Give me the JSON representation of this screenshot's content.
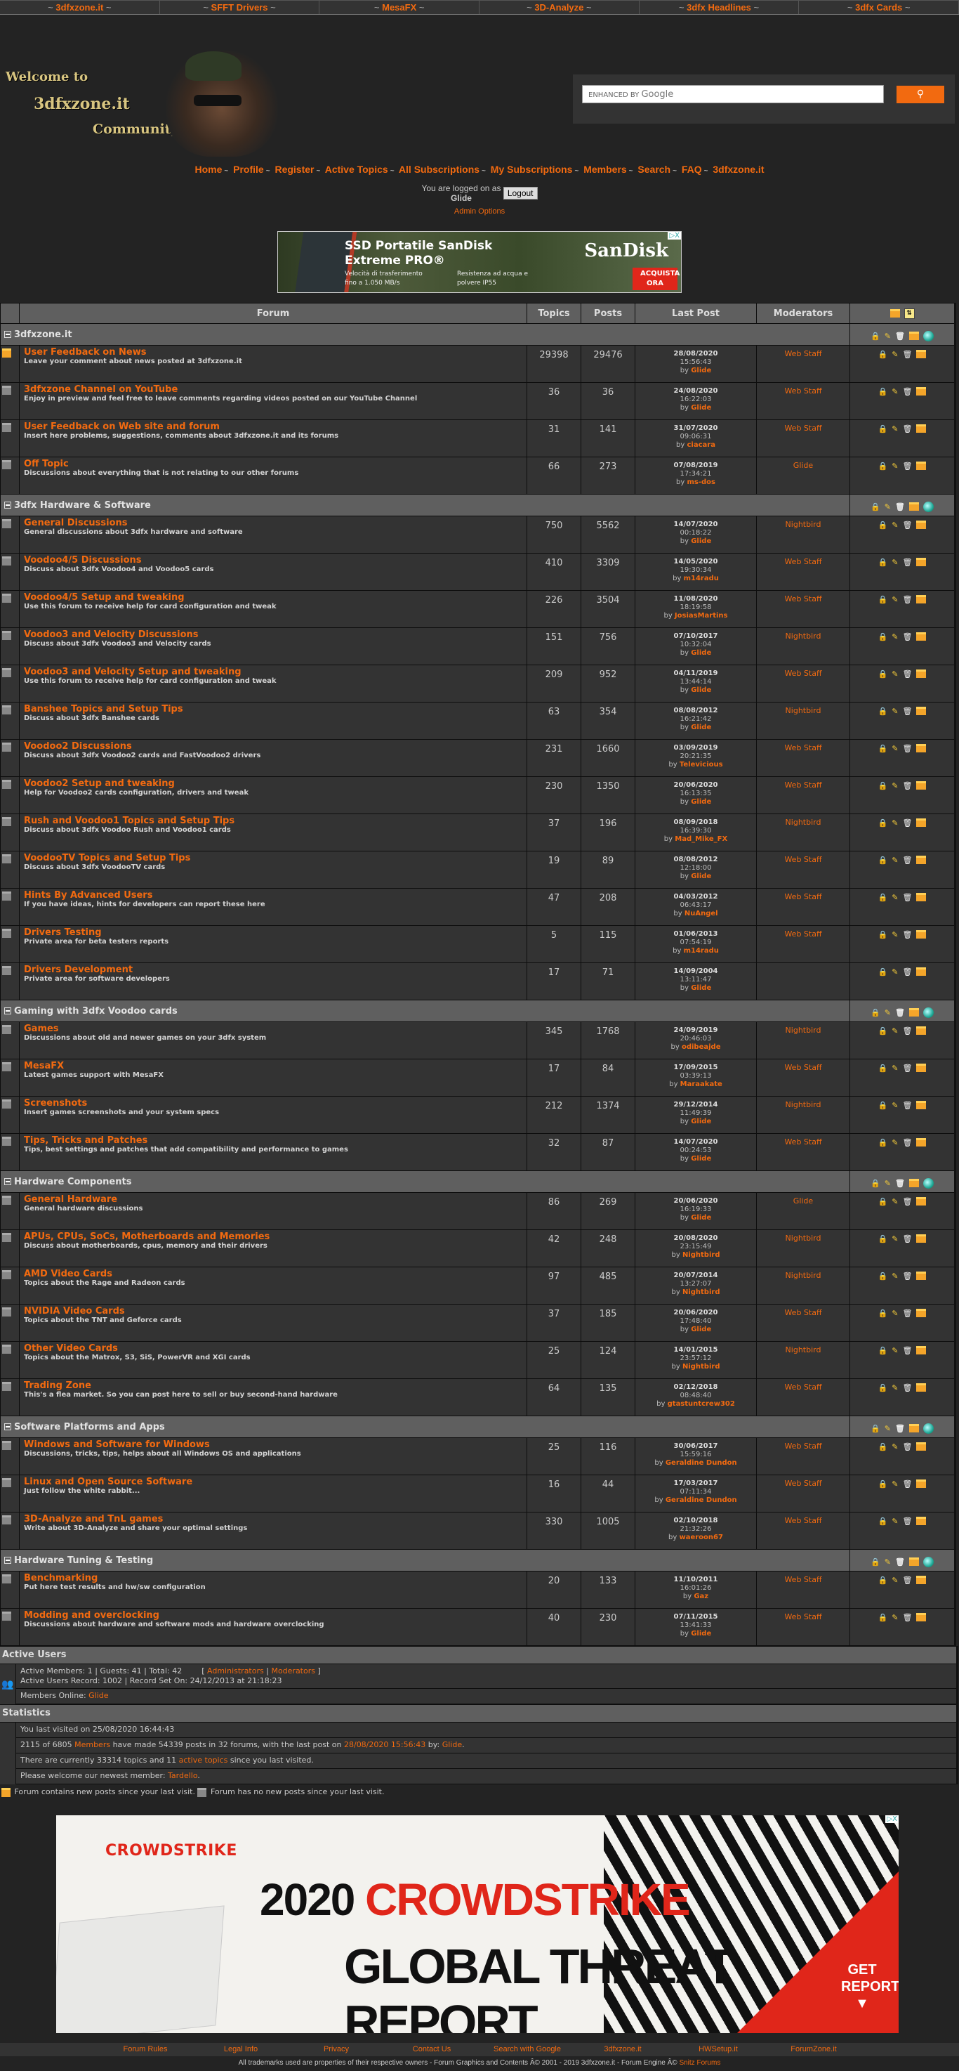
{
  "top_nav": [
    "3dfxzone.it",
    "SFFT Drivers",
    "MesaFX",
    "3D-Analyze",
    "3dfx Headlines",
    "3dfx Cards"
  ],
  "logo": {
    "line1": "Welcome to",
    "line2": "3dfxzone.it",
    "line3": "Community"
  },
  "search": {
    "placeholder_prefix": "ENHANCED BY",
    "placeholder_brand": "Google",
    "button_icon": "search-icon"
  },
  "main_nav": [
    "Home",
    "Profile",
    "Register",
    "Active Topics",
    "All Subscriptions",
    "My Subscriptions",
    "Members",
    "Search",
    "FAQ",
    "3dfxzone.it"
  ],
  "login": {
    "text": "You are logged on as",
    "user": "Glide",
    "logout": "Logout",
    "admin_options": "Admin Options"
  },
  "ad_top": {
    "title_line1": "SSD Portatile SanDisk",
    "title_line2": "Extreme PRO®",
    "bullet1": "Velocità di trasferimento fino a 1.050 MB/s",
    "bullet2": "Resistenza ad acqua e polvere IP55",
    "brand": "SanDisk",
    "cta": "ACQUISTA ORA",
    "adchoices": "▷X"
  },
  "table": {
    "headers": {
      "forum": "Forum",
      "topics": "Topics",
      "posts": "Posts",
      "last_post": "Last Post",
      "moderators": "Moderators"
    },
    "by_label": "by",
    "categories": [
      {
        "name": "3dfxzone.it",
        "forums": [
          {
            "title": "User Feedback on News",
            "desc": "Leave your comment about news posted at 3dfxzone.it",
            "topics": "29398",
            "posts": "29476",
            "date": "28/08/2020",
            "time": "15:56:43",
            "by": "Glide",
            "mod": "Web Staff",
            "new": true
          },
          {
            "title": "3dfxzone Channel on YouTube",
            "desc": "Enjoy in preview and feel free to leave comments regarding videos posted on our YouTube Channel",
            "topics": "36",
            "posts": "36",
            "date": "24/08/2020",
            "time": "16:22:03",
            "by": "Glide",
            "mod": "Web Staff",
            "new": false
          },
          {
            "title": "User Feedback on Web site and forum",
            "desc": "Insert here problems, suggestions, comments about 3dfxzone.it and its forums",
            "topics": "31",
            "posts": "141",
            "date": "31/07/2020",
            "time": "09:06:31",
            "by": "ciacara",
            "mod": "Web Staff",
            "new": false
          },
          {
            "title": "Off Topic",
            "desc": "Discussions about everything that is not relating to our other forums",
            "topics": "66",
            "posts": "273",
            "date": "07/08/2019",
            "time": "17:34:21",
            "by": "ms-dos",
            "mod": "Glide",
            "new": false
          }
        ]
      },
      {
        "name": "3dfx Hardware & Software",
        "forums": [
          {
            "title": "General Discussions",
            "desc": "General discussions about 3dfx hardware and software",
            "topics": "750",
            "posts": "5562",
            "date": "14/07/2020",
            "time": "00:18:22",
            "by": "Glide",
            "mod": "Nightbird",
            "new": false
          },
          {
            "title": "Voodoo4/5 Discussions",
            "desc": "Discuss about 3dfx Voodoo4 and Voodoo5 cards",
            "topics": "410",
            "posts": "3309",
            "date": "14/05/2020",
            "time": "19:30:34",
            "by": "m14radu",
            "mod": "Web Staff",
            "new": false
          },
          {
            "title": "Voodoo4/5 Setup and tweaking",
            "desc": "Use this forum to receive help for card configuration and tweak",
            "topics": "226",
            "posts": "3504",
            "date": "11/08/2020",
            "time": "18:19:58",
            "by": "JosiasMartins",
            "mod": "Web Staff",
            "new": false
          },
          {
            "title": "Voodoo3 and Velocity Discussions",
            "desc": "Discuss about 3dfx Voodoo3 and Velocity cards",
            "topics": "151",
            "posts": "756",
            "date": "07/10/2017",
            "time": "10:32:04",
            "by": "Glide",
            "mod": "Nightbird",
            "new": false
          },
          {
            "title": "Voodoo3 and Velocity Setup and tweaking",
            "desc": "Use this forum to receive help for card configuration and tweak",
            "topics": "209",
            "posts": "952",
            "date": "04/11/2019",
            "time": "13:44:14",
            "by": "Glide",
            "mod": "Web Staff",
            "new": false
          },
          {
            "title": "Banshee Topics and Setup Tips",
            "desc": "Discuss about 3dfx Banshee cards",
            "topics": "63",
            "posts": "354",
            "date": "08/08/2012",
            "time": "16:21:42",
            "by": "Glide",
            "mod": "Nightbird",
            "new": false
          },
          {
            "title": "Voodoo2 Discussions",
            "desc": "Discuss about 3dfx Voodoo2 cards and FastVoodoo2 drivers",
            "topics": "231",
            "posts": "1660",
            "date": "03/09/2019",
            "time": "20:21:35",
            "by": "Televicious",
            "mod": "Web Staff",
            "new": false
          },
          {
            "title": "Voodoo2 Setup and tweaking",
            "desc": "Help for Voodoo2 cards configuration, drivers and tweak",
            "topics": "230",
            "posts": "1350",
            "date": "20/06/2020",
            "time": "16:13:35",
            "by": "Glide",
            "mod": "Web Staff",
            "new": false
          },
          {
            "title": "Rush and Voodoo1 Topics and Setup Tips",
            "desc": "Discuss about 3dfx Voodoo Rush and Voodoo1 cards",
            "topics": "37",
            "posts": "196",
            "date": "08/09/2018",
            "time": "16:39:30",
            "by": "Mad_Mike_FX",
            "mod": "Nightbird",
            "new": false
          },
          {
            "title": "VoodooTV Topics and Setup Tips",
            "desc": "Discuss about 3dfx VoodooTV cards",
            "topics": "19",
            "posts": "89",
            "date": "08/08/2012",
            "time": "12:18:00",
            "by": "Glide",
            "mod": "Web Staff",
            "new": false
          },
          {
            "title": "Hints By Advanced Users",
            "desc": "If you have ideas, hints for developers can report these here",
            "topics": "47",
            "posts": "208",
            "date": "04/03/2012",
            "time": "06:43:17",
            "by": "NuAngel",
            "mod": "Web Staff",
            "new": false
          },
          {
            "title": "Drivers Testing",
            "desc": "Private area for beta testers reports",
            "topics": "5",
            "posts": "115",
            "date": "01/06/2013",
            "time": "07:54:19",
            "by": "m14radu",
            "mod": "Web Staff",
            "new": false
          },
          {
            "title": "Drivers Development",
            "desc": "Private area for software developers",
            "topics": "17",
            "posts": "71",
            "date": "14/09/2004",
            "time": "13:11:47",
            "by": "Glide",
            "mod": "",
            "new": false
          }
        ]
      },
      {
        "name": "Gaming with 3dfx Voodoo cards",
        "forums": [
          {
            "title": "Games",
            "desc": "Discussions about old and newer games on your 3dfx system",
            "topics": "345",
            "posts": "1768",
            "date": "24/09/2019",
            "time": "20:46:03",
            "by": "odibeajde",
            "mod": "Nightbird",
            "new": false
          },
          {
            "title": "MesaFX",
            "desc": "Latest games support with MesaFX",
            "topics": "17",
            "posts": "84",
            "date": "17/09/2015",
            "time": "03:39:13",
            "by": "Maraakate",
            "mod": "Web Staff",
            "new": false
          },
          {
            "title": "Screenshots",
            "desc": "Insert games screenshots and your system specs",
            "topics": "212",
            "posts": "1374",
            "date": "29/12/2014",
            "time": "11:49:39",
            "by": "Glide",
            "mod": "Nightbird",
            "new": false
          },
          {
            "title": "Tips, Tricks and Patches",
            "desc": "Tips, best settings and patches that add compatibility and performance to games",
            "topics": "32",
            "posts": "87",
            "date": "14/07/2020",
            "time": "00:24:53",
            "by": "Glide",
            "mod": "Web Staff",
            "new": false
          }
        ]
      },
      {
        "name": "Hardware Components",
        "forums": [
          {
            "title": "General Hardware",
            "desc": "General hardware discussions",
            "topics": "86",
            "posts": "269",
            "date": "20/06/2020",
            "time": "16:19:33",
            "by": "Glide",
            "mod": "Glide",
            "new": false
          },
          {
            "title": "APUs, CPUs, SoCs, Motherboards and Memories",
            "desc": "Discuss about motherboards, cpus, memory and their drivers",
            "topics": "42",
            "posts": "248",
            "date": "20/08/2020",
            "time": "23:15:49",
            "by": "Nightbird",
            "mod": "Nightbird",
            "new": false
          },
          {
            "title": "AMD Video Cards",
            "desc": "Topics about the Rage and Radeon cards",
            "topics": "97",
            "posts": "485",
            "date": "20/07/2014",
            "time": "13:27:07",
            "by": "Nightbird",
            "mod": "Nightbird",
            "new": false
          },
          {
            "title": "NVIDIA Video Cards",
            "desc": "Topics about the TNT and Geforce cards",
            "topics": "37",
            "posts": "185",
            "date": "20/06/2020",
            "time": "17:48:40",
            "by": "Glide",
            "mod": "Web Staff",
            "new": false
          },
          {
            "title": "Other Video Cards",
            "desc": "Topics about the Matrox, S3, SiS, PowerVR and XGI cards",
            "topics": "25",
            "posts": "124",
            "date": "14/01/2015",
            "time": "23:57:12",
            "by": "Nightbird",
            "mod": "Nightbird",
            "new": false
          },
          {
            "title": "Trading Zone",
            "desc": "This's a flea market. So you can post here to sell or buy second-hand hardware",
            "topics": "64",
            "posts": "135",
            "date": "02/12/2018",
            "time": "08:48:40",
            "by": "gtastuntcrew302",
            "mod": "Web Staff",
            "new": false
          }
        ]
      },
      {
        "name": "Software Platforms and Apps",
        "forums": [
          {
            "title": "Windows and Software for Windows",
            "desc": "Discussions, tricks, tips, helps about all Windows OS and applications",
            "topics": "25",
            "posts": "116",
            "date": "30/06/2017",
            "time": "15:59:16",
            "by": "Geraldine Dundon",
            "mod": "Web Staff",
            "new": false
          },
          {
            "title": "Linux and Open Source Software",
            "desc": "Just follow the white rabbit...",
            "topics": "16",
            "posts": "44",
            "date": "17/03/2017",
            "time": "07:11:34",
            "by": "Geraldine Dundon",
            "mod": "Web Staff",
            "new": false
          },
          {
            "title": "3D-Analyze and TnL games",
            "desc": "Write about 3D-Analyze and share your optimal settings",
            "topics": "330",
            "posts": "1005",
            "date": "02/10/2018",
            "time": "21:32:26",
            "by": "waeroon67",
            "mod": "Web Staff",
            "new": false
          }
        ]
      },
      {
        "name": "Hardware Tuning & Testing",
        "forums": [
          {
            "title": "Benchmarking",
            "desc": "Put here test results and hw/sw configuration",
            "topics": "20",
            "posts": "133",
            "date": "11/10/2011",
            "time": "16:01:26",
            "by": "Gaz",
            "mod": "Web Staff",
            "new": false
          },
          {
            "title": "Modding and overclocking",
            "desc": "Discussions about hardware and software mods and hardware overclocking",
            "topics": "40",
            "posts": "230",
            "date": "07/11/2015",
            "time": "13:41:33",
            "by": "Glide",
            "mod": "Web Staff",
            "new": false
          }
        ]
      }
    ]
  },
  "active_users": {
    "title": "Active Users",
    "counts": "Active Members: 1 | Guests: 41 | Total: 42",
    "bracket_open": "[",
    "administrators": "Administrators",
    "pipe": "|",
    "moderators": "Moderators",
    "bracket_close": "]",
    "record": "Active Users Record: 1002 | Record Set On: 24/12/2013 at 21:18:23",
    "members_online_label": "Members Online:",
    "members_online": "Glide"
  },
  "statistics": {
    "title": "Statistics",
    "last_visit": "You last visited on 25/08/2020 16:44:43",
    "line2_a": "2115 of 6805",
    "line2_members": "Members",
    "line2_b": "have made 54339 posts in 32 forums, with the last post on",
    "line2_date": "28/08/2020 15:56:43",
    "line2_c": "by:",
    "line2_user": "Glide",
    "line3_a": "There are currently 33314 topics and 11",
    "line3_link": "active topics",
    "line3_b": "since you last visited.",
    "line4_a": "Please welcome our newest member:",
    "line4_user": "Tardello"
  },
  "legend": {
    "new_posts": "Forum contains new posts since your last visit.",
    "no_new_posts": "Forum has no new posts since your last visit."
  },
  "ad_bottom": {
    "logo": "CROWDSTRIKE",
    "headline_year": "2020",
    "headline_brand": "CROWDSTRIKE",
    "headline2": "GLOBAL THREAT REPORT",
    "cta": "GET REPORT",
    "adchoices": "▷X"
  },
  "footer": {
    "links": [
      "Forum Rules",
      "Legal Info",
      "Privacy",
      "Contact Us",
      "Search with Google",
      "3dfxzone.it",
      "HWSetup.it",
      "ForumZone.it"
    ],
    "copyright": "All trademarks used are properties of their respective owners - Forum Graphics and Contents Â© 2001 - 2019 3dfxzone.it - Forum Engine Â©",
    "engine_link": "Snitz Forums"
  },
  "colors": {
    "accent": "#f26a10",
    "bg": "#232323",
    "row": "#333333",
    "header": "#5f5f5f"
  }
}
